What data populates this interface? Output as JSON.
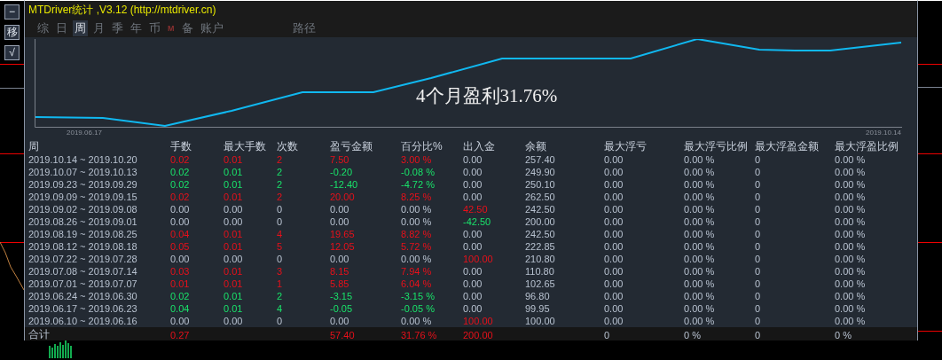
{
  "sidebar_buttons": [
    {
      "label": "−"
    },
    {
      "label": "移"
    },
    {
      "label": "√"
    }
  ],
  "window": {
    "title": "MTDriver统计 ,V3.12 (http://mtdriver.cn)"
  },
  "tabs": [
    {
      "label": "综",
      "kind": "char",
      "selected": false
    },
    {
      "label": "日",
      "kind": "char",
      "selected": false
    },
    {
      "label": "周",
      "kind": "char",
      "selected": true
    },
    {
      "label": "月",
      "kind": "char",
      "selected": false
    },
    {
      "label": "季",
      "kind": "char",
      "selected": false
    },
    {
      "label": "年",
      "kind": "char",
      "selected": false
    },
    {
      "label": "币",
      "kind": "char",
      "selected": false
    },
    {
      "label": "M",
      "kind": "mark",
      "selected": false
    },
    {
      "label": "备",
      "kind": "char",
      "selected": false
    },
    {
      "label": "账户",
      "kind": "char",
      "selected": false
    },
    {
      "label": "路径",
      "kind": "far",
      "selected": false
    }
  ],
  "chart": {
    "start_label": "2019.06.17",
    "end_label": "2019.10.14",
    "annotation": "4个月盈利31.76%"
  },
  "table": {
    "columns": [
      "周",
      "手数",
      "最大手数",
      "次数",
      "盈亏金额",
      "百分比%",
      "出入金",
      "余额",
      "最大浮亏",
      "最大浮亏比例",
      "最大浮盈金额",
      "最大浮盈比例"
    ],
    "rows": [
      {
        "cells": [
          {
            "text": "2019.10.14 ~ 2019.10.20"
          },
          {
            "text": "0.02",
            "kind": "up"
          },
          {
            "text": "0.01",
            "kind": "up"
          },
          {
            "text": "2",
            "kind": "up"
          },
          {
            "text": "7.50",
            "kind": "up"
          },
          {
            "text": "3.00 %",
            "kind": "up"
          },
          {
            "text": "0.00"
          },
          {
            "text": "257.40"
          },
          {
            "text": "0.00"
          },
          {
            "text": "0.00 %"
          },
          {
            "text": "0"
          },
          {
            "text": "0.00 %"
          }
        ]
      },
      {
        "cells": [
          {
            "text": "2019.10.07 ~ 2019.10.13"
          },
          {
            "text": "0.02",
            "kind": "down"
          },
          {
            "text": "0.01",
            "kind": "down"
          },
          {
            "text": "2",
            "kind": "down"
          },
          {
            "text": "-0.20",
            "kind": "down"
          },
          {
            "text": "-0.08 %",
            "kind": "down"
          },
          {
            "text": "0.00"
          },
          {
            "text": "249.90"
          },
          {
            "text": "0.00"
          },
          {
            "text": "0.00 %"
          },
          {
            "text": "0"
          },
          {
            "text": "0.00 %"
          }
        ]
      },
      {
        "cells": [
          {
            "text": "2019.09.23 ~ 2019.09.29"
          },
          {
            "text": "0.02",
            "kind": "down"
          },
          {
            "text": "0.01",
            "kind": "down"
          },
          {
            "text": "2",
            "kind": "down"
          },
          {
            "text": "-12.40",
            "kind": "down"
          },
          {
            "text": "-4.72 %",
            "kind": "down"
          },
          {
            "text": "0.00"
          },
          {
            "text": "250.10"
          },
          {
            "text": "0.00"
          },
          {
            "text": "0.00 %"
          },
          {
            "text": "0"
          },
          {
            "text": "0.00 %"
          }
        ]
      },
      {
        "cells": [
          {
            "text": "2019.09.09 ~ 2019.09.15"
          },
          {
            "text": "0.02",
            "kind": "up"
          },
          {
            "text": "0.01",
            "kind": "up"
          },
          {
            "text": "2",
            "kind": "up"
          },
          {
            "text": "20.00",
            "kind": "up"
          },
          {
            "text": "8.25 %",
            "kind": "up"
          },
          {
            "text": "0.00"
          },
          {
            "text": "262.50"
          },
          {
            "text": "0.00"
          },
          {
            "text": "0.00 %"
          },
          {
            "text": "0"
          },
          {
            "text": "0.00 %"
          }
        ]
      },
      {
        "cells": [
          {
            "text": "2019.09.02 ~ 2019.09.08"
          },
          {
            "text": "0.00"
          },
          {
            "text": "0.00"
          },
          {
            "text": "0"
          },
          {
            "text": "0.00"
          },
          {
            "text": "0.00 %"
          },
          {
            "text": "42.50",
            "kind": "up"
          },
          {
            "text": "242.50"
          },
          {
            "text": "0.00"
          },
          {
            "text": "0.00 %"
          },
          {
            "text": "0"
          },
          {
            "text": "0.00 %"
          }
        ]
      },
      {
        "cells": [
          {
            "text": "2019.08.26 ~ 2019.09.01"
          },
          {
            "text": "0.00"
          },
          {
            "text": "0.00"
          },
          {
            "text": "0"
          },
          {
            "text": "0.00"
          },
          {
            "text": "0.00 %"
          },
          {
            "text": "-42.50",
            "kind": "down"
          },
          {
            "text": "200.00"
          },
          {
            "text": "0.00"
          },
          {
            "text": "0.00 %"
          },
          {
            "text": "0"
          },
          {
            "text": "0.00 %"
          }
        ]
      },
      {
        "cells": [
          {
            "text": "2019.08.19 ~ 2019.08.25"
          },
          {
            "text": "0.04",
            "kind": "up"
          },
          {
            "text": "0.01",
            "kind": "up"
          },
          {
            "text": "4",
            "kind": "up"
          },
          {
            "text": "19.65",
            "kind": "up"
          },
          {
            "text": "8.82 %",
            "kind": "up"
          },
          {
            "text": "0.00"
          },
          {
            "text": "242.50"
          },
          {
            "text": "0.00"
          },
          {
            "text": "0.00 %"
          },
          {
            "text": "0"
          },
          {
            "text": "0.00 %"
          }
        ]
      },
      {
        "cells": [
          {
            "text": "2019.08.12 ~ 2019.08.18"
          },
          {
            "text": "0.05",
            "kind": "up"
          },
          {
            "text": "0.01",
            "kind": "up"
          },
          {
            "text": "5",
            "kind": "up"
          },
          {
            "text": "12.05",
            "kind": "up"
          },
          {
            "text": "5.72 %",
            "kind": "up"
          },
          {
            "text": "0.00"
          },
          {
            "text": "222.85"
          },
          {
            "text": "0.00"
          },
          {
            "text": "0.00 %"
          },
          {
            "text": "0"
          },
          {
            "text": "0.00 %"
          }
        ]
      },
      {
        "cells": [
          {
            "text": "2019.07.22 ~ 2019.07.28"
          },
          {
            "text": "0.00"
          },
          {
            "text": "0.00"
          },
          {
            "text": "0"
          },
          {
            "text": "0.00"
          },
          {
            "text": "0.00 %"
          },
          {
            "text": "100.00",
            "kind": "up"
          },
          {
            "text": "210.80"
          },
          {
            "text": "0.00"
          },
          {
            "text": "0.00 %"
          },
          {
            "text": "0"
          },
          {
            "text": "0.00 %"
          }
        ]
      },
      {
        "cells": [
          {
            "text": "2019.07.08 ~ 2019.07.14"
          },
          {
            "text": "0.03",
            "kind": "up"
          },
          {
            "text": "0.01",
            "kind": "up"
          },
          {
            "text": "3",
            "kind": "up"
          },
          {
            "text": "8.15",
            "kind": "up"
          },
          {
            "text": "7.94 %",
            "kind": "up"
          },
          {
            "text": "0.00"
          },
          {
            "text": "110.80"
          },
          {
            "text": "0.00"
          },
          {
            "text": "0.00 %"
          },
          {
            "text": "0"
          },
          {
            "text": "0.00 %"
          }
        ]
      },
      {
        "cells": [
          {
            "text": "2019.07.01 ~ 2019.07.07"
          },
          {
            "text": "0.01",
            "kind": "up"
          },
          {
            "text": "0.01",
            "kind": "up"
          },
          {
            "text": "1",
            "kind": "up"
          },
          {
            "text": "5.85",
            "kind": "up"
          },
          {
            "text": "6.04 %",
            "kind": "up"
          },
          {
            "text": "0.00"
          },
          {
            "text": "102.65"
          },
          {
            "text": "0.00"
          },
          {
            "text": "0.00 %"
          },
          {
            "text": "0"
          },
          {
            "text": "0.00 %"
          }
        ]
      },
      {
        "cells": [
          {
            "text": "2019.06.24 ~ 2019.06.30"
          },
          {
            "text": "0.02",
            "kind": "down"
          },
          {
            "text": "0.01",
            "kind": "down"
          },
          {
            "text": "2",
            "kind": "down"
          },
          {
            "text": "-3.15",
            "kind": "down"
          },
          {
            "text": "-3.15 %",
            "kind": "down"
          },
          {
            "text": "0.00"
          },
          {
            "text": "96.80"
          },
          {
            "text": "0.00"
          },
          {
            "text": "0.00 %"
          },
          {
            "text": "0"
          },
          {
            "text": "0.00 %"
          }
        ]
      },
      {
        "cells": [
          {
            "text": "2019.06.17 ~ 2019.06.23"
          },
          {
            "text": "0.04",
            "kind": "down"
          },
          {
            "text": "0.01",
            "kind": "down"
          },
          {
            "text": "4",
            "kind": "down"
          },
          {
            "text": "-0.05",
            "kind": "down"
          },
          {
            "text": "-0.05 %",
            "kind": "down"
          },
          {
            "text": "0.00"
          },
          {
            "text": "99.95"
          },
          {
            "text": "0.00"
          },
          {
            "text": "0.00 %"
          },
          {
            "text": "0"
          },
          {
            "text": "0.00 %"
          }
        ]
      },
      {
        "cells": [
          {
            "text": "2019.06.10 ~ 2019.06.16"
          },
          {
            "text": "0.00"
          },
          {
            "text": "0.00"
          },
          {
            "text": "0"
          },
          {
            "text": "0.00"
          },
          {
            "text": "0.00 %"
          },
          {
            "text": "100.00",
            "kind": "up"
          },
          {
            "text": "100.00"
          },
          {
            "text": "0.00"
          },
          {
            "text": "0.00 %"
          },
          {
            "text": "0"
          },
          {
            "text": "0.00 %"
          }
        ]
      }
    ],
    "total": {
      "cells": [
        {
          "text": "合计"
        },
        {
          "text": "0.27",
          "kind": "up"
        },
        null,
        null,
        {
          "text": "57.40",
          "kind": "up"
        },
        {
          "text": "31.76 %",
          "kind": "up"
        },
        {
          "text": "200.00",
          "kind": "up"
        },
        null,
        {
          "text": "0"
        },
        {
          "text": "0 %"
        },
        {
          "text": "0"
        },
        {
          "text": "0 %"
        }
      ]
    }
  }
}
